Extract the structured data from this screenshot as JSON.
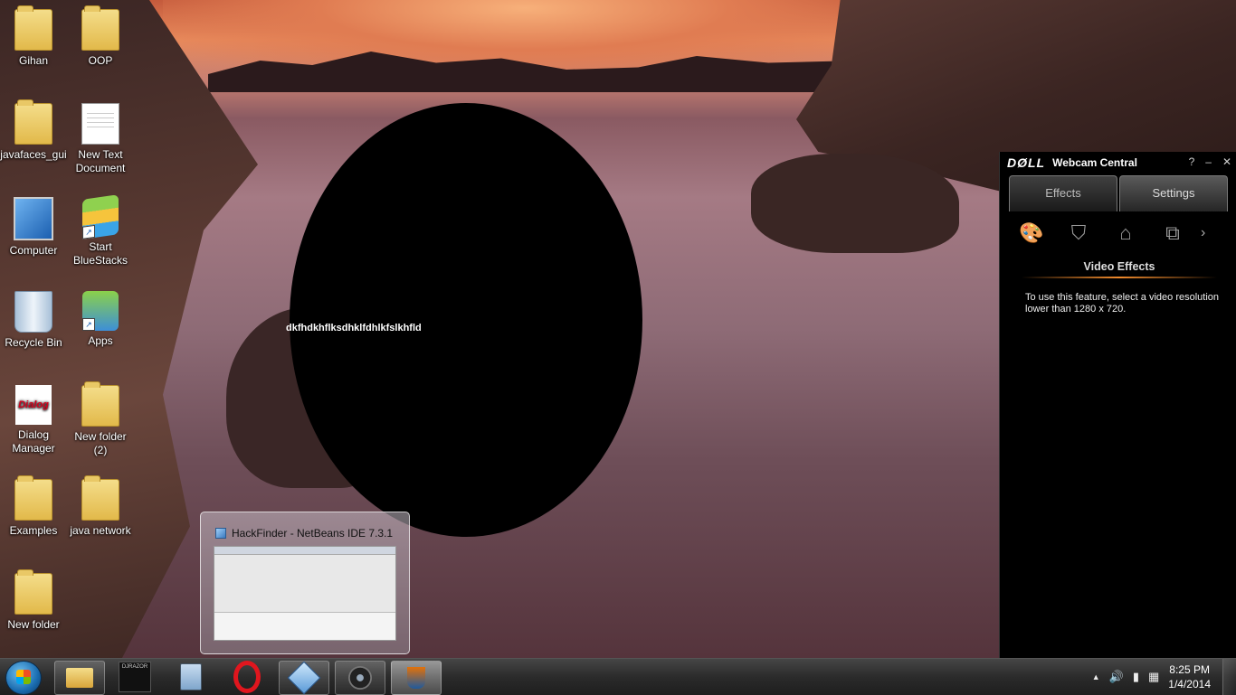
{
  "desktop_icons": [
    {
      "label": "Gihan",
      "icon": "user-folder-icon"
    },
    {
      "label": "OOP",
      "icon": "folder-icon"
    },
    {
      "label": "javafaces_gui",
      "icon": "folder-icon"
    },
    {
      "label": "New Text Document",
      "icon": "text-document-icon"
    },
    {
      "label": "Computer",
      "icon": "computer-icon"
    },
    {
      "label": "Start BlueStacks",
      "icon": "bluestacks-icon"
    },
    {
      "label": "Recycle Bin",
      "icon": "recycle-bin-icon"
    },
    {
      "label": "Apps",
      "icon": "apps-icon"
    },
    {
      "label": "Dialog Manager",
      "icon": "dialog-icon"
    },
    {
      "label": "New folder (2)",
      "icon": "folder-icon"
    },
    {
      "label": "Examples",
      "icon": "folder-icon"
    },
    {
      "label": "java network",
      "icon": "folder-icon"
    },
    {
      "label": "New folder",
      "icon": "folder-icon"
    }
  ],
  "overlay": {
    "text": "dkfhdkhflksdhklfdhlkfslkhfld"
  },
  "webcam": {
    "logo": "DØLL",
    "title": "Webcam Central",
    "help": "?",
    "minimize": "–",
    "close": "✕",
    "tabs": [
      "Effects",
      "Settings"
    ],
    "section_title": "Video Effects",
    "message": "To use this feature, select a video resolution lower than 1280 x 720.",
    "more": "›"
  },
  "thumbnail": {
    "title": "HackFinder - NetBeans IDE 7.3.1"
  },
  "taskbar": {
    "pinned": [
      "file-explorer-icon",
      "sinhala-app-icon",
      "calculator-icon",
      "opera-icon",
      "netbeans-icon",
      "webcam-icon",
      "java-icon"
    ],
    "dialog_logo_text": "Dialog",
    "sinhala_text": "DJRAZOR"
  },
  "clock": {
    "time": "8:25 PM",
    "date": "1/4/2014"
  },
  "tray": {
    "expand": "▲",
    "volume": "🔊"
  }
}
